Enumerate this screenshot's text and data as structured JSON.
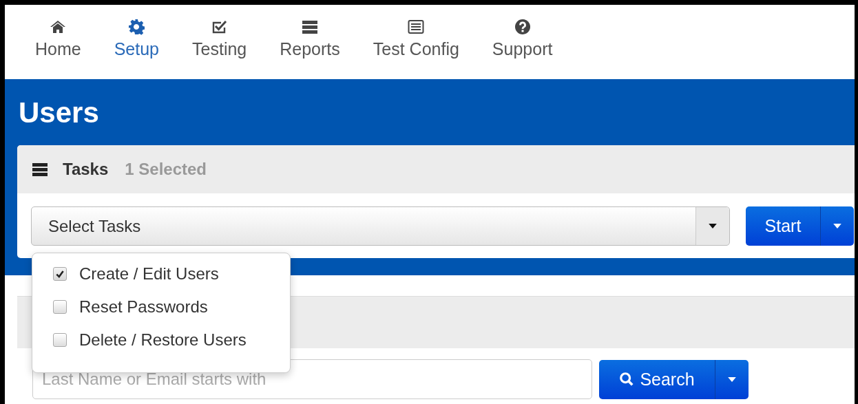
{
  "nav": [
    {
      "label": "Home",
      "selected": false
    },
    {
      "label": "Setup",
      "selected": true
    },
    {
      "label": "Testing",
      "selected": false
    },
    {
      "label": "Reports",
      "selected": false
    },
    {
      "label": "Test Config",
      "selected": false
    },
    {
      "label": "Support",
      "selected": false
    }
  ],
  "page_title": "Users",
  "tasks_panel": {
    "title": "Tasks",
    "count": "1 Selected",
    "select": {
      "value": "Select Tasks"
    },
    "start_button": "Start"
  },
  "task_menu": [
    {
      "label": "Create / Edit Users",
      "checked": true
    },
    {
      "label": "Reset Passwords",
      "checked": false
    },
    {
      "label": "Delete / Restore Users",
      "checked": false
    }
  ],
  "search": {
    "placeholder": "Last Name or Email starts with",
    "button": "Search"
  }
}
